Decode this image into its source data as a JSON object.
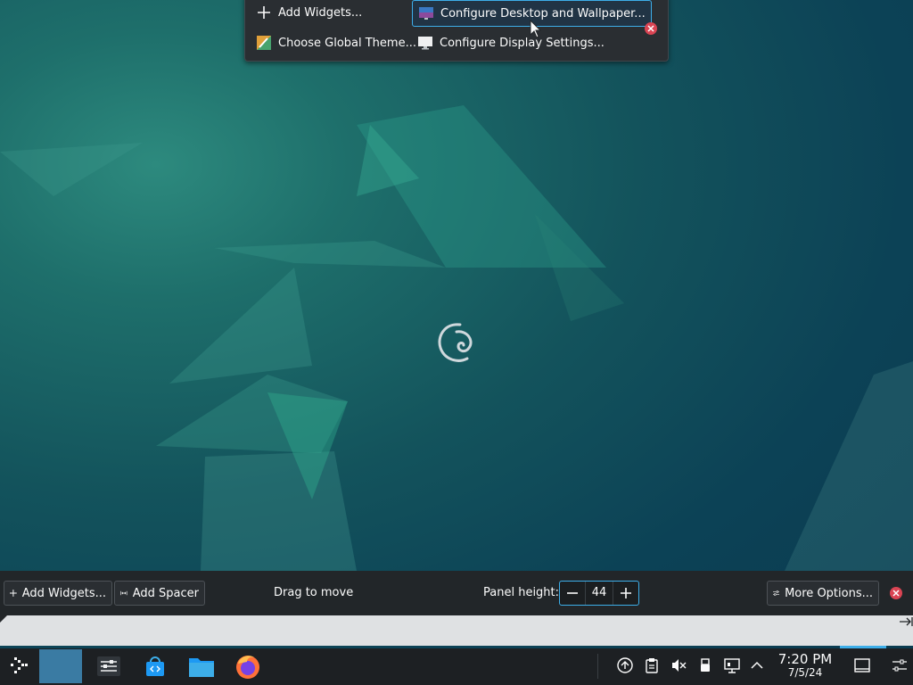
{
  "top_toolbar": {
    "add_widgets": "Add Widgets...",
    "configure_desktop": "Configure Desktop and Wallpaper...",
    "choose_theme": "Choose Global Theme...",
    "configure_display": "Configure Display Settings..."
  },
  "panel_config": {
    "add_widgets": "Add Widgets...",
    "add_spacer": "Add Spacer",
    "drag_to_move": "Drag to move",
    "panel_height_label": "Panel height:",
    "panel_height_value": "44",
    "more_options": "More Options..."
  },
  "taskbar": {
    "time": "7:20 PM",
    "date": "7/5/24"
  },
  "colors": {
    "accent": "#3daee9",
    "close": "#da4453",
    "panel_bg": "#222629",
    "taskbar_bg": "#1d2023"
  }
}
